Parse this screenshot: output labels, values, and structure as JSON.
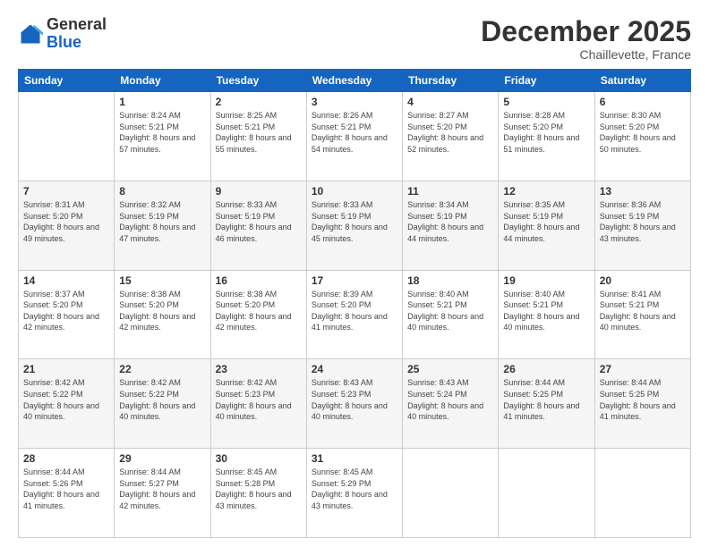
{
  "header": {
    "logo_general": "General",
    "logo_blue": "Blue",
    "month_title": "December 2025",
    "subtitle": "Chaillevette, France"
  },
  "weekdays": [
    "Sunday",
    "Monday",
    "Tuesday",
    "Wednesday",
    "Thursday",
    "Friday",
    "Saturday"
  ],
  "weeks": [
    [
      {
        "day": "",
        "sunrise": "",
        "sunset": "",
        "daylight": ""
      },
      {
        "day": "1",
        "sunrise": "Sunrise: 8:24 AM",
        "sunset": "Sunset: 5:21 PM",
        "daylight": "Daylight: 8 hours and 57 minutes."
      },
      {
        "day": "2",
        "sunrise": "Sunrise: 8:25 AM",
        "sunset": "Sunset: 5:21 PM",
        "daylight": "Daylight: 8 hours and 55 minutes."
      },
      {
        "day": "3",
        "sunrise": "Sunrise: 8:26 AM",
        "sunset": "Sunset: 5:21 PM",
        "daylight": "Daylight: 8 hours and 54 minutes."
      },
      {
        "day": "4",
        "sunrise": "Sunrise: 8:27 AM",
        "sunset": "Sunset: 5:20 PM",
        "daylight": "Daylight: 8 hours and 52 minutes."
      },
      {
        "day": "5",
        "sunrise": "Sunrise: 8:28 AM",
        "sunset": "Sunset: 5:20 PM",
        "daylight": "Daylight: 8 hours and 51 minutes."
      },
      {
        "day": "6",
        "sunrise": "Sunrise: 8:30 AM",
        "sunset": "Sunset: 5:20 PM",
        "daylight": "Daylight: 8 hours and 50 minutes."
      }
    ],
    [
      {
        "day": "7",
        "sunrise": "Sunrise: 8:31 AM",
        "sunset": "Sunset: 5:20 PM",
        "daylight": "Daylight: 8 hours and 49 minutes."
      },
      {
        "day": "8",
        "sunrise": "Sunrise: 8:32 AM",
        "sunset": "Sunset: 5:19 PM",
        "daylight": "Daylight: 8 hours and 47 minutes."
      },
      {
        "day": "9",
        "sunrise": "Sunrise: 8:33 AM",
        "sunset": "Sunset: 5:19 PM",
        "daylight": "Daylight: 8 hours and 46 minutes."
      },
      {
        "day": "10",
        "sunrise": "Sunrise: 8:33 AM",
        "sunset": "Sunset: 5:19 PM",
        "daylight": "Daylight: 8 hours and 45 minutes."
      },
      {
        "day": "11",
        "sunrise": "Sunrise: 8:34 AM",
        "sunset": "Sunset: 5:19 PM",
        "daylight": "Daylight: 8 hours and 44 minutes."
      },
      {
        "day": "12",
        "sunrise": "Sunrise: 8:35 AM",
        "sunset": "Sunset: 5:19 PM",
        "daylight": "Daylight: 8 hours and 44 minutes."
      },
      {
        "day": "13",
        "sunrise": "Sunrise: 8:36 AM",
        "sunset": "Sunset: 5:19 PM",
        "daylight": "Daylight: 8 hours and 43 minutes."
      }
    ],
    [
      {
        "day": "14",
        "sunrise": "Sunrise: 8:37 AM",
        "sunset": "Sunset: 5:20 PM",
        "daylight": "Daylight: 8 hours and 42 minutes."
      },
      {
        "day": "15",
        "sunrise": "Sunrise: 8:38 AM",
        "sunset": "Sunset: 5:20 PM",
        "daylight": "Daylight: 8 hours and 42 minutes."
      },
      {
        "day": "16",
        "sunrise": "Sunrise: 8:38 AM",
        "sunset": "Sunset: 5:20 PM",
        "daylight": "Daylight: 8 hours and 42 minutes."
      },
      {
        "day": "17",
        "sunrise": "Sunrise: 8:39 AM",
        "sunset": "Sunset: 5:20 PM",
        "daylight": "Daylight: 8 hours and 41 minutes."
      },
      {
        "day": "18",
        "sunrise": "Sunrise: 8:40 AM",
        "sunset": "Sunset: 5:21 PM",
        "daylight": "Daylight: 8 hours and 40 minutes."
      },
      {
        "day": "19",
        "sunrise": "Sunrise: 8:40 AM",
        "sunset": "Sunset: 5:21 PM",
        "daylight": "Daylight: 8 hours and 40 minutes."
      },
      {
        "day": "20",
        "sunrise": "Sunrise: 8:41 AM",
        "sunset": "Sunset: 5:21 PM",
        "daylight": "Daylight: 8 hours and 40 minutes."
      }
    ],
    [
      {
        "day": "21",
        "sunrise": "Sunrise: 8:42 AM",
        "sunset": "Sunset: 5:22 PM",
        "daylight": "Daylight: 8 hours and 40 minutes."
      },
      {
        "day": "22",
        "sunrise": "Sunrise: 8:42 AM",
        "sunset": "Sunset: 5:22 PM",
        "daylight": "Daylight: 8 hours and 40 minutes."
      },
      {
        "day": "23",
        "sunrise": "Sunrise: 8:42 AM",
        "sunset": "Sunset: 5:23 PM",
        "daylight": "Daylight: 8 hours and 40 minutes."
      },
      {
        "day": "24",
        "sunrise": "Sunrise: 8:43 AM",
        "sunset": "Sunset: 5:23 PM",
        "daylight": "Daylight: 8 hours and 40 minutes."
      },
      {
        "day": "25",
        "sunrise": "Sunrise: 8:43 AM",
        "sunset": "Sunset: 5:24 PM",
        "daylight": "Daylight: 8 hours and 40 minutes."
      },
      {
        "day": "26",
        "sunrise": "Sunrise: 8:44 AM",
        "sunset": "Sunset: 5:25 PM",
        "daylight": "Daylight: 8 hours and 41 minutes."
      },
      {
        "day": "27",
        "sunrise": "Sunrise: 8:44 AM",
        "sunset": "Sunset: 5:25 PM",
        "daylight": "Daylight: 8 hours and 41 minutes."
      }
    ],
    [
      {
        "day": "28",
        "sunrise": "Sunrise: 8:44 AM",
        "sunset": "Sunset: 5:26 PM",
        "daylight": "Daylight: 8 hours and 41 minutes."
      },
      {
        "day": "29",
        "sunrise": "Sunrise: 8:44 AM",
        "sunset": "Sunset: 5:27 PM",
        "daylight": "Daylight: 8 hours and 42 minutes."
      },
      {
        "day": "30",
        "sunrise": "Sunrise: 8:45 AM",
        "sunset": "Sunset: 5:28 PM",
        "daylight": "Daylight: 8 hours and 43 minutes."
      },
      {
        "day": "31",
        "sunrise": "Sunrise: 8:45 AM",
        "sunset": "Sunset: 5:29 PM",
        "daylight": "Daylight: 8 hours and 43 minutes."
      },
      {
        "day": "",
        "sunrise": "",
        "sunset": "",
        "daylight": ""
      },
      {
        "day": "",
        "sunrise": "",
        "sunset": "",
        "daylight": ""
      },
      {
        "day": "",
        "sunrise": "",
        "sunset": "",
        "daylight": ""
      }
    ]
  ]
}
